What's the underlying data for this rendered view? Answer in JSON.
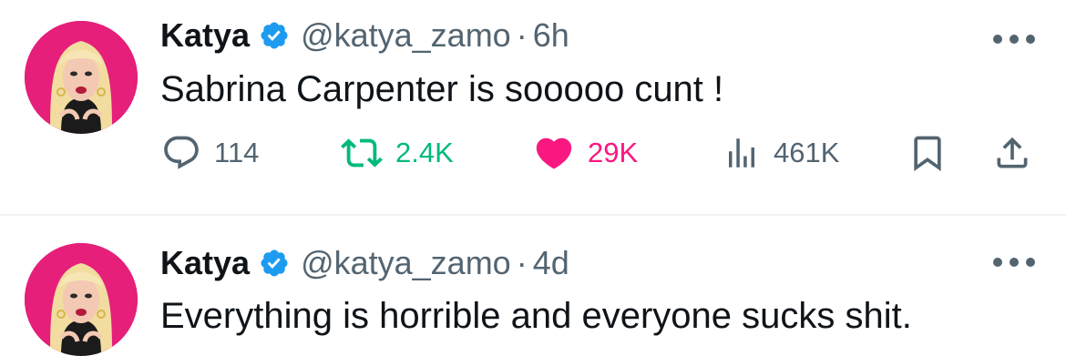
{
  "colors": {
    "text_primary": "#0f1419",
    "text_secondary": "#536471",
    "verified_blue": "#1d9bf0",
    "retweet_green": "#00ba7c",
    "like_pink": "#f91880",
    "avatar_bg": "#e51f7a"
  },
  "tweets": [
    {
      "author_name": "Katya",
      "handle": "@katya_zamo",
      "separator": "·",
      "time": "6h",
      "text": "Sabrina Carpenter is sooooo cunt !",
      "verified": true,
      "actions": {
        "replies": "114",
        "retweets": "2.4K",
        "likes": "29K",
        "views": "461K",
        "liked": true,
        "icons": [
          "reply-icon",
          "retweet-icon",
          "heart-icon",
          "views-icon",
          "bookmark-icon",
          "share-icon"
        ]
      }
    },
    {
      "author_name": "Katya",
      "handle": "@katya_zamo",
      "separator": "·",
      "time": "4d",
      "text": "Everything is horrible and everyone sucks shit.",
      "verified": true
    }
  ]
}
